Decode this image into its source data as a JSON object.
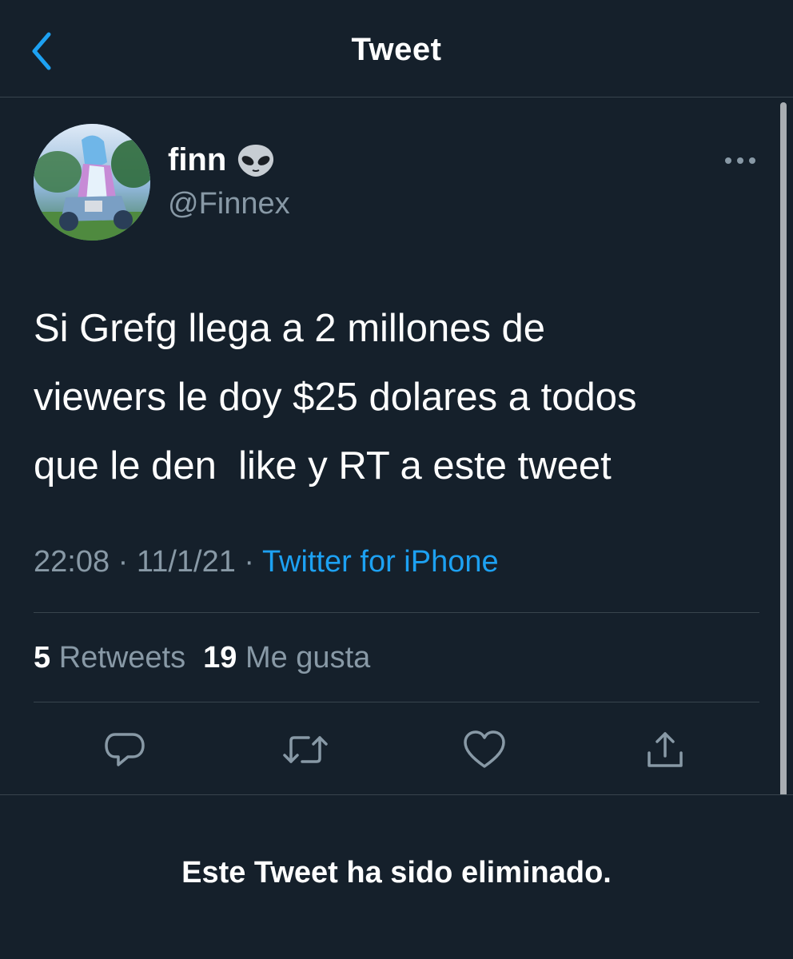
{
  "header": {
    "title": "Tweet"
  },
  "author": {
    "name": "finn",
    "handle": "@Finnex"
  },
  "tweet": {
    "text": "Si Grefg llega a 2 millones de\nviewers le doy $25 dolares a todos\nque le den  like y RT a este tweet",
    "time": "22:08",
    "date": "11/1/21",
    "source": "Twitter for iPhone",
    "separator": " · "
  },
  "stats": {
    "retweets_count": "5",
    "retweets_label": "Retweets",
    "likes_count": "19",
    "likes_label": "Me gusta"
  },
  "deleted_notice": "Este Tweet ha sido eliminado.",
  "colors": {
    "background": "#15202b",
    "accent": "#1da1f2",
    "secondary_text": "#8899a6",
    "divider": "#38444d"
  },
  "icons": [
    "chevron-left-icon",
    "alien-emoji-icon",
    "more-options-icon",
    "reply-icon",
    "retweet-icon",
    "like-icon",
    "share-icon"
  ]
}
